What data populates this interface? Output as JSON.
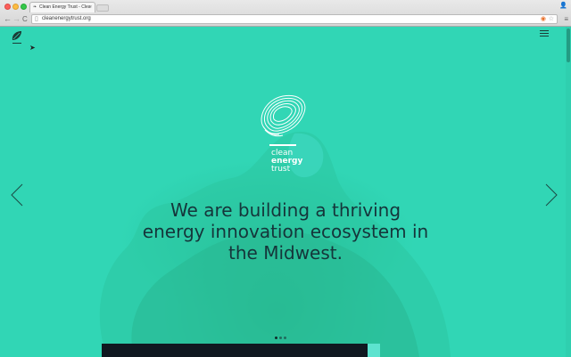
{
  "browser": {
    "tab_title": "Clean Energy Trust - Clea",
    "tab_close": "×",
    "url": "cleanenergytrust.org",
    "nav_back": "←",
    "nav_forward": "→",
    "nav_reload": "C",
    "menu": "≡"
  },
  "site": {
    "brand_lines": [
      "clean",
      "energy",
      "trust"
    ],
    "headline_lines": [
      "We are building a thriving",
      "energy innovation ecosystem in",
      "the Midwest."
    ],
    "carousel": {
      "slides": 3,
      "active_index": 0
    }
  },
  "colors": {
    "accent": "#31d6b5",
    "headline": "#15353a",
    "bottom_bar": "#101820"
  }
}
